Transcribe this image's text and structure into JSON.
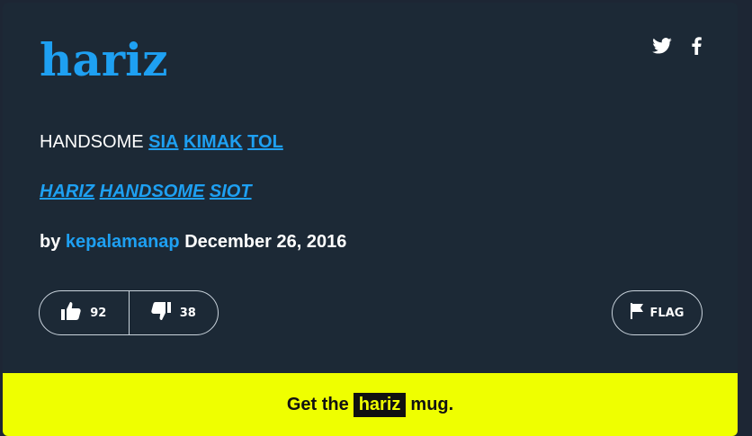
{
  "entry": {
    "word": "hariz",
    "meaning_prefix": "HANDSOME",
    "meaning_links": [
      "SIA",
      "KIMAK",
      "TOL"
    ],
    "example_links": [
      "HARIZ",
      "HANDSOME",
      "SIOT"
    ],
    "by_label": "by",
    "author": "kepalamanap",
    "date": "December 26, 2016"
  },
  "actions": {
    "upvotes": "92",
    "downvotes": "38",
    "flag_label": "FLAG"
  },
  "social": [
    "twitter-icon",
    "facebook-icon"
  ],
  "mug": {
    "prefix": "Get the",
    "word": "hariz",
    "suffix": "mug."
  },
  "colors": {
    "background": "#1c2936",
    "accent": "#1ea0f2",
    "mug_banner": "#efff00"
  }
}
